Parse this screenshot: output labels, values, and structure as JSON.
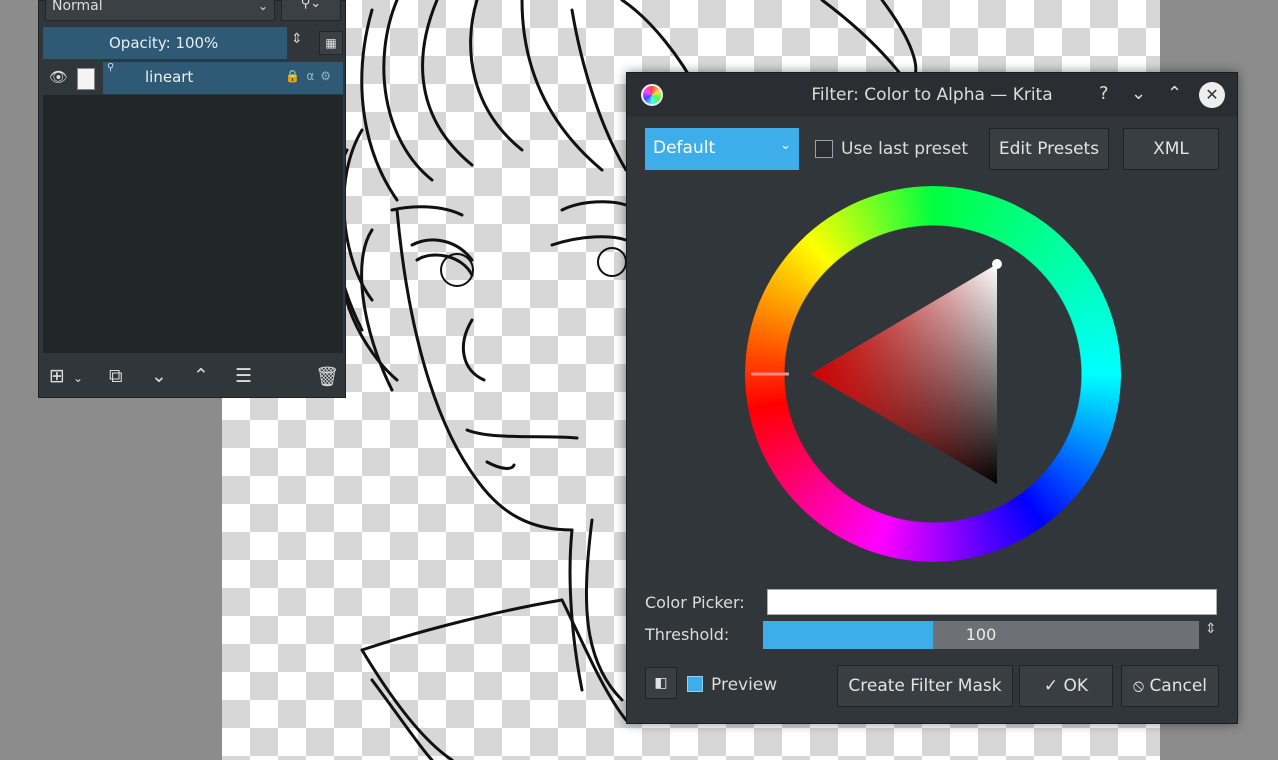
{
  "layers": {
    "blend_mode": "Normal",
    "opacity_label": "Opacity:  100%",
    "layer_name": "lineart",
    "toolbar_icons": [
      "add-layer-icon",
      "duplicate-layer-icon",
      "move-down-icon",
      "move-up-icon",
      "properties-icon",
      "delete-icon"
    ]
  },
  "dialog": {
    "title": "Filter: Color to Alpha — Krita",
    "help": "?",
    "minimize": "⌄",
    "maximize": "⌃",
    "close": "✕",
    "preset": "Default",
    "use_last_preset": "Use last preset",
    "edit_presets": "Edit Presets",
    "xml": "XML",
    "color_picker_label": "Color Picker:",
    "color_value": "#ffffff",
    "threshold_label": "Threshold:",
    "threshold_value": "100",
    "threshold_fraction": 0.39,
    "preview_label": "Preview",
    "create_filter_mask": "Create Filter Mask",
    "ok": "✓ OK",
    "cancel": "⦸ Cancel",
    "accent": "#3daee9"
  }
}
